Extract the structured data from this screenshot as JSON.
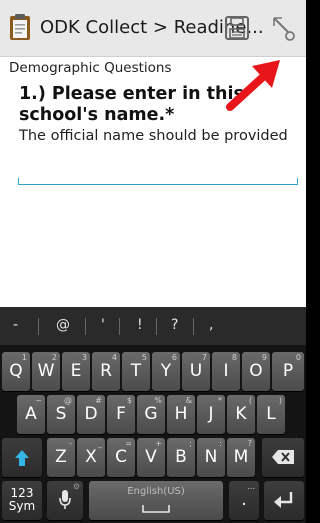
{
  "appbar": {
    "title": "ODK Collect > Readine..."
  },
  "form": {
    "group_name": "Demographic Questions",
    "question_label": "1.) Please enter in this school's name.*",
    "hint": "The official name should be provided"
  },
  "keyboard": {
    "suggestions": [
      "-",
      "@",
      "'",
      "!",
      "?",
      ","
    ],
    "row1": [
      {
        "main": "Q",
        "sup": "1"
      },
      {
        "main": "W",
        "sup": "2"
      },
      {
        "main": "E",
        "sup": "3"
      },
      {
        "main": "R",
        "sup": "4"
      },
      {
        "main": "T",
        "sup": "5"
      },
      {
        "main": "Y",
        "sup": "6"
      },
      {
        "main": "U",
        "sup": "7"
      },
      {
        "main": "I",
        "sup": "8"
      },
      {
        "main": "O",
        "sup": "9"
      },
      {
        "main": "P",
        "sup": "0"
      }
    ],
    "row2": [
      {
        "main": "A",
        "sup": "~"
      },
      {
        "main": "S",
        "sup": "@"
      },
      {
        "main": "D",
        "sup": "#"
      },
      {
        "main": "F",
        "sup": "$"
      },
      {
        "main": "G",
        "sup": "%"
      },
      {
        "main": "H",
        "sup": "&"
      },
      {
        "main": "J",
        "sup": "*"
      },
      {
        "main": "K",
        "sup": "("
      },
      {
        "main": "L",
        "sup": ")"
      }
    ],
    "row3": [
      {
        "main": "Z",
        "sup": "-"
      },
      {
        "main": "X",
        "sup": "_"
      },
      {
        "main": "C",
        "sup": "="
      },
      {
        "main": "V",
        "sup": "+"
      },
      {
        "main": "B",
        "sup": ";"
      },
      {
        "main": "N",
        "sup": ":"
      },
      {
        "main": "M",
        "sup": "?"
      }
    ],
    "sym_label_top": "123",
    "sym_label_bottom": "Sym",
    "space_label": "English(US)",
    "period_label": ".",
    "period_sup": "..."
  },
  "colors": {
    "accent_underline": "#2f9fd0",
    "arrow": "#e8151b"
  }
}
